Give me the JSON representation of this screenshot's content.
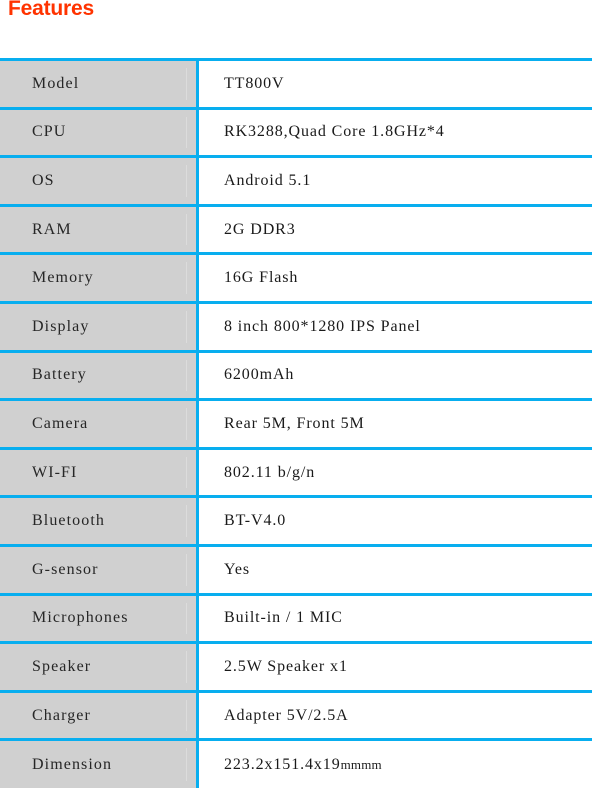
{
  "document": {
    "title": "Features",
    "title_color": "#ff3300"
  },
  "theme": {
    "border_color": "#08aeef",
    "label_background": "#d0d0d0",
    "value_background": "#ffffff",
    "text_color": "#1a1a1a"
  },
  "spec_table": {
    "rows": [
      {
        "label": "Model",
        "value": "TT800V"
      },
      {
        "label": "CPU",
        "value": "RK3288,Quad Core 1.8GHz*4"
      },
      {
        "label": "OS",
        "value": "Android 5.1"
      },
      {
        "label": "RAM",
        "value": "2G DDR3"
      },
      {
        "label": "Memory",
        "value": "16G Flash"
      },
      {
        "label": "Display",
        "value": "8 inch 800*1280 IPS Panel"
      },
      {
        "label": "Battery",
        "value": "6200mAh"
      },
      {
        "label": "Camera",
        "value": "Rear 5M, Front 5M"
      },
      {
        "label": "WI-FI",
        "value": "802.11 b/g/n"
      },
      {
        "label": "Bluetooth",
        "value": "BT-V4.0"
      },
      {
        "label": "G-sensor",
        "value": "Yes"
      },
      {
        "label": "Microphones",
        "value": "Built-in / 1 MIC"
      },
      {
        "label": "Speaker",
        "value": "2.5W Speaker x1"
      },
      {
        "label": "Charger",
        "value": "Adapter 5V/2.5A"
      },
      {
        "label": "Dimension",
        "value": "223.2x151.4x19",
        "value_unit": "mmmm"
      }
    ]
  }
}
